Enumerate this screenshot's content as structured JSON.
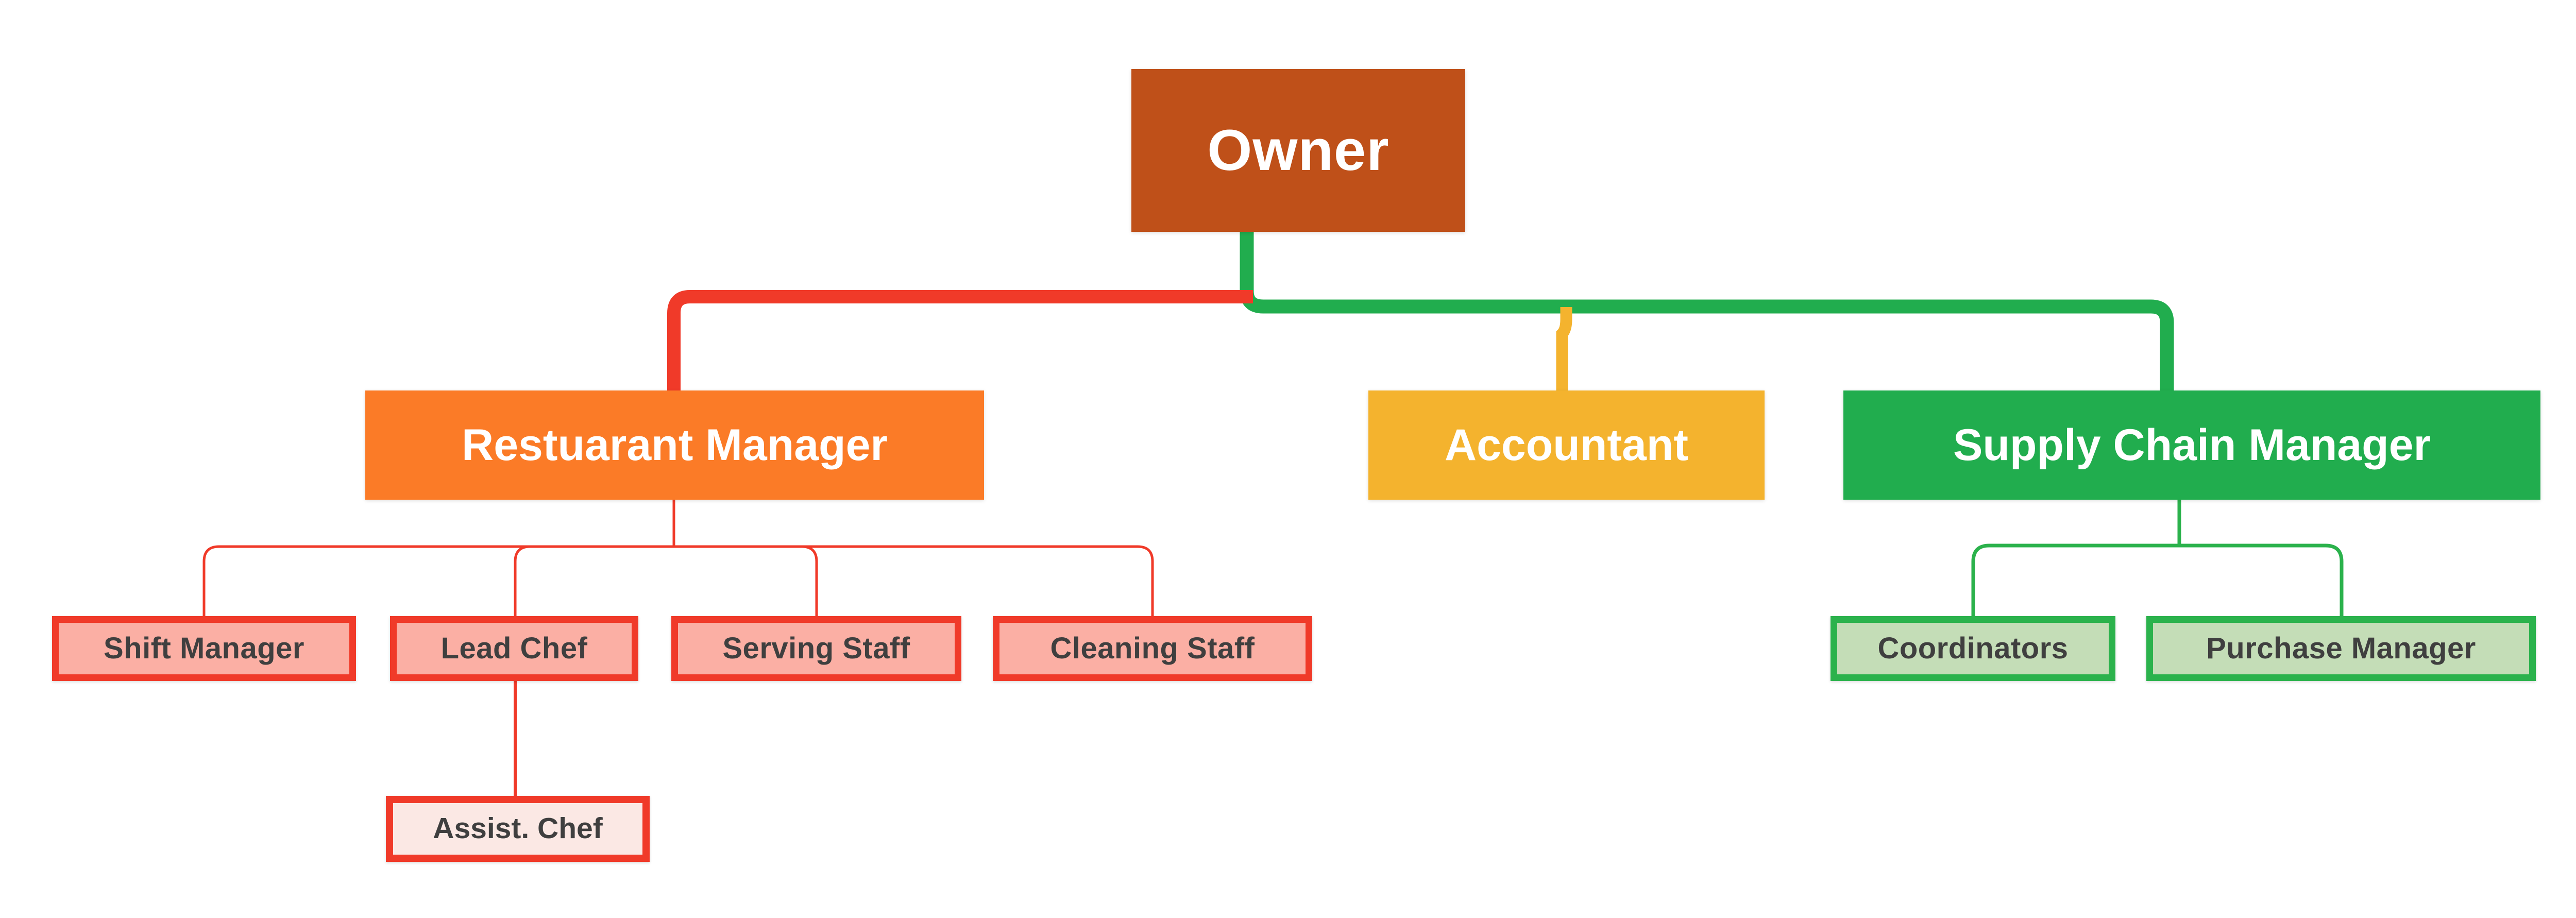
{
  "chart_data": {
    "type": "diagram",
    "diagram_type": "organizational-chart",
    "title": "",
    "background_color": "#ffffff",
    "nodes": [
      {
        "id": "owner",
        "label": "Owner",
        "level": 0,
        "fill": "#BF5019",
        "text_color": "#ffffff"
      },
      {
        "id": "restaurant-manager",
        "label": "Restuarant Manager",
        "level": 1,
        "parent": "owner",
        "fill": "#FB7B27",
        "text_color": "#ffffff"
      },
      {
        "id": "accountant",
        "label": "Accountant",
        "level": 1,
        "parent": "owner",
        "fill": "#F4B32E",
        "text_color": "#ffffff"
      },
      {
        "id": "supply-chain-manager",
        "label": "Supply Chain Manager",
        "level": 1,
        "parent": "owner",
        "fill": "#21AD4E",
        "text_color": "#ffffff"
      },
      {
        "id": "shift-manager",
        "label": "Shift Manager",
        "level": 2,
        "parent": "restaurant-manager",
        "fill": "#FBAFA4",
        "border": "#F03A29",
        "text_color": "#3F3F3F"
      },
      {
        "id": "lead-chef",
        "label": "Lead Chef",
        "level": 2,
        "parent": "restaurant-manager",
        "fill": "#FBAFA4",
        "border": "#F03A29",
        "text_color": "#3F3F3F"
      },
      {
        "id": "serving-staff",
        "label": "Serving Staff",
        "level": 2,
        "parent": "restaurant-manager",
        "fill": "#FBAFA4",
        "border": "#F03A29",
        "text_color": "#3F3F3F"
      },
      {
        "id": "cleaning-staff",
        "label": "Cleaning Staff",
        "level": 2,
        "parent": "restaurant-manager",
        "fill": "#FBAFA4",
        "border": "#F03A29",
        "text_color": "#3F3F3F"
      },
      {
        "id": "assist-chef",
        "label": "Assist. Chef",
        "level": 3,
        "parent": "lead-chef",
        "fill": "#FBE8E4",
        "border": "#F03A29",
        "text_color": "#3F3F3F"
      },
      {
        "id": "coordinators",
        "label": "Coordinators",
        "level": 2,
        "parent": "supply-chain-manager",
        "fill": "#C4DDB7",
        "border": "#2BB24C",
        "text_color": "#3F3F3F"
      },
      {
        "id": "purchase-manager",
        "label": "Purchase Manager",
        "level": 2,
        "parent": "supply-chain-manager",
        "fill": "#C4DDB7",
        "border": "#2BB24C",
        "text_color": "#3F3F3F"
      }
    ],
    "edges": [
      {
        "from": "owner",
        "to": "restaurant-manager",
        "color": "#F03A29",
        "width": 26
      },
      {
        "from": "owner",
        "to": "accountant",
        "color": "#F4B32E",
        "width": 22
      },
      {
        "from": "owner",
        "to": "supply-chain-manager",
        "color": "#21AD4E",
        "width": 26
      },
      {
        "from": "restaurant-manager",
        "to": "shift-manager",
        "color": "#F03A29",
        "width": 5
      },
      {
        "from": "restaurant-manager",
        "to": "lead-chef",
        "color": "#F03A29",
        "width": 5
      },
      {
        "from": "restaurant-manager",
        "to": "serving-staff",
        "color": "#F03A29",
        "width": 5
      },
      {
        "from": "restaurant-manager",
        "to": "cleaning-staff",
        "color": "#F03A29",
        "width": 5
      },
      {
        "from": "lead-chef",
        "to": "assist-chef",
        "color": "#F03A29",
        "width": 6
      },
      {
        "from": "supply-chain-manager",
        "to": "coordinators",
        "color": "#2BB24C",
        "width": 6
      },
      {
        "from": "supply-chain-manager",
        "to": "purchase-manager",
        "color": "#2BB24C",
        "width": 6
      }
    ],
    "palette": {
      "owner_brown": "#BF5019",
      "manager_orange": "#FB7B27",
      "accountant_amber": "#F4B32E",
      "supply_green": "#21AD4E",
      "leaf_red_border": "#F03A29",
      "leaf_red_fill": "#FBAFA4",
      "leaf_pink_fill": "#FBE8E4",
      "leaf_green_border": "#2BB24C",
      "leaf_green_fill": "#C4DDB7",
      "leaf_text": "#3F3F3F",
      "background": "#ffffff"
    }
  },
  "nodes": {
    "owner": {
      "label": "Owner"
    },
    "restaurant_manager": {
      "label": "Restuarant Manager"
    },
    "accountant": {
      "label": "Accountant"
    },
    "supply_chain_manager": {
      "label": "Supply Chain Manager"
    },
    "shift_manager": {
      "label": "Shift Manager"
    },
    "lead_chef": {
      "label": "Lead Chef"
    },
    "serving_staff": {
      "label": "Serving Staff"
    },
    "cleaning_staff": {
      "label": "Cleaning Staff"
    },
    "assist_chef": {
      "label": "Assist. Chef"
    },
    "coordinators": {
      "label": "Coordinators"
    },
    "purchase_manager": {
      "label": "Purchase Manager"
    }
  }
}
